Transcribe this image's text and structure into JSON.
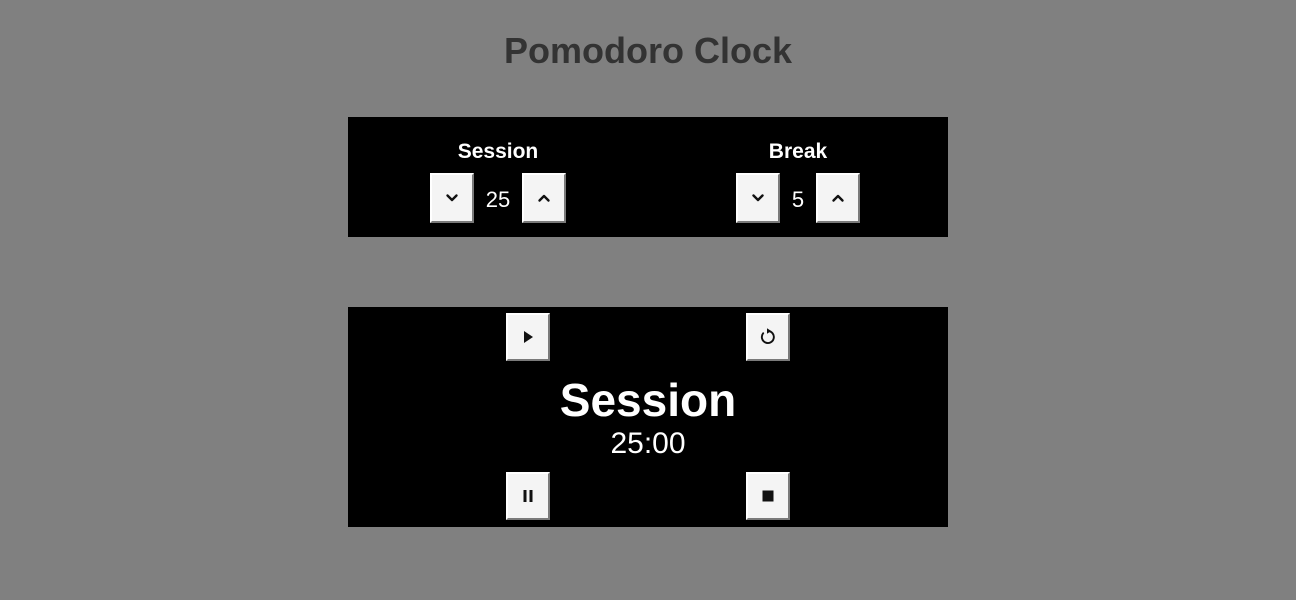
{
  "app": {
    "title": "Pomodoro Clock",
    "background_color": "#808080",
    "title_color": "#333333",
    "panel_color": "#000000"
  },
  "settings": {
    "session": {
      "label": "Session",
      "value": "25",
      "decrement_icon": "chevron-down-icon",
      "increment_icon": "chevron-up-icon"
    },
    "break": {
      "label": "Break",
      "value": "5",
      "decrement_icon": "chevron-down-icon",
      "increment_icon": "chevron-up-icon"
    }
  },
  "timer": {
    "label": "Session",
    "display": "25:00",
    "controls": {
      "play_icon": "play-icon",
      "reset_icon": "reset-icon",
      "pause_icon": "pause-icon",
      "stop_icon": "stop-icon"
    }
  }
}
